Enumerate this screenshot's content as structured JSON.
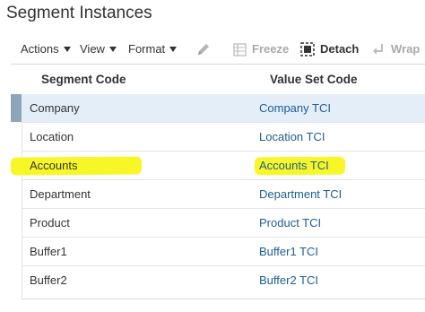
{
  "page": {
    "title": "Segment Instances"
  },
  "toolbar": {
    "actions": "Actions",
    "view": "View",
    "format": "Format",
    "freeze": "Freeze",
    "detach": "Detach",
    "wrap": "Wrap"
  },
  "table": {
    "columns": [
      "Segment Code",
      "Value Set Code"
    ],
    "rows": [
      {
        "segment": "Company",
        "value_set": "Company TCI",
        "selected": true
      },
      {
        "segment": "Location",
        "value_set": "Location TCI"
      },
      {
        "segment": "Accounts",
        "value_set": "Accounts TCI",
        "highlighted": true
      },
      {
        "segment": "Department",
        "value_set": "Department TCI"
      },
      {
        "segment": "Product",
        "value_set": "Product TCI"
      },
      {
        "segment": "Buffer1",
        "value_set": "Buffer1 TCI"
      },
      {
        "segment": "Buffer2",
        "value_set": "Buffer2 TCI"
      }
    ]
  },
  "colors": {
    "selected_row": "#e3eef9",
    "highlight": "#f7f71c",
    "link": "#1f5d91"
  }
}
